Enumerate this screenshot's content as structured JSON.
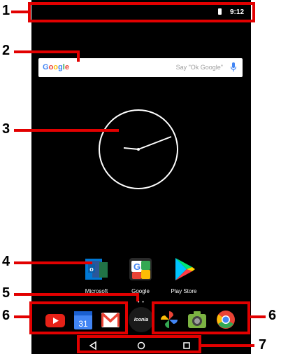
{
  "status_bar": {
    "time": "9:12"
  },
  "search": {
    "logo_letters": [
      "G",
      "o",
      "o",
      "g",
      "l",
      "e"
    ],
    "logo_colors": [
      "#4285F4",
      "#EA4335",
      "#FBBC05",
      "#4285F4",
      "#34A853",
      "#EA4335"
    ],
    "hint": "Say \"Ok Google\"",
    "mic_color": "#4285F4"
  },
  "clock": {
    "hour_hand": "8",
    "minute_hand": "12"
  },
  "apps": [
    {
      "label": "Microsoft",
      "icon": "microsoft-folder-icon"
    },
    {
      "label": "Google",
      "icon": "google-folder-icon"
    },
    {
      "label": "Play Store",
      "icon": "play-store-icon"
    }
  ],
  "page_indicator": "• •",
  "dock": {
    "left": [
      {
        "icon": "youtube-icon",
        "color": "#E62117"
      },
      {
        "icon": "calendar-icon",
        "text": "31",
        "color": "#4285F4"
      },
      {
        "icon": "gmail-icon",
        "color": "#EA4335"
      }
    ],
    "center": {
      "label": "Iconia",
      "icon": "iconia-icon"
    },
    "right": [
      {
        "icon": "photos-icon"
      },
      {
        "icon": "camera-icon"
      },
      {
        "icon": "chrome-icon"
      }
    ]
  },
  "nav": {
    "back": "◁",
    "home": "○",
    "recents": "□"
  },
  "annotations": {
    "color": "#e20000",
    "numbers": [
      "1",
      "2",
      "3",
      "4",
      "5",
      "6",
      "6",
      "7"
    ]
  }
}
